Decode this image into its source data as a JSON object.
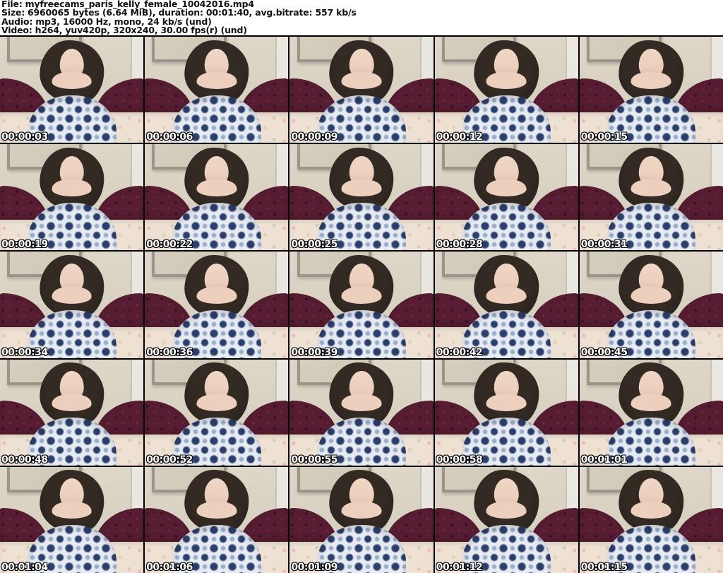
{
  "header": {
    "lines": [
      {
        "label": "File:",
        "value": "myfreecams_paris_kelly_female_10042016.mp4"
      },
      {
        "label": "Size:",
        "value": "6960065 bytes (6.64 MiB), duration: 00:01:40, avg.bitrate: 557 kb/s"
      },
      {
        "label": "Audio:",
        "value": "mp3, 16000 Hz, mono, 24 kb/s (und)"
      },
      {
        "label": "Video:",
        "value": "h264, yuv420p, 320x240, 30.00 fps(r) (und)"
      }
    ]
  },
  "grid": {
    "columns": 5,
    "rows": 5
  },
  "thumbnails": [
    {
      "timestamp": "00:00:03"
    },
    {
      "timestamp": "00:00:06"
    },
    {
      "timestamp": "00:00:09"
    },
    {
      "timestamp": "00:00:12"
    },
    {
      "timestamp": "00:00:15"
    },
    {
      "timestamp": "00:00:19"
    },
    {
      "timestamp": "00:00:22"
    },
    {
      "timestamp": "00:00:25"
    },
    {
      "timestamp": "00:00:28"
    },
    {
      "timestamp": "00:00:31"
    },
    {
      "timestamp": "00:00:34"
    },
    {
      "timestamp": "00:00:36"
    },
    {
      "timestamp": "00:00:39"
    },
    {
      "timestamp": "00:00:42"
    },
    {
      "timestamp": "00:00:45"
    },
    {
      "timestamp": "00:00:48"
    },
    {
      "timestamp": "00:00:52"
    },
    {
      "timestamp": "00:00:55"
    },
    {
      "timestamp": "00:00:58"
    },
    {
      "timestamp": "00:01:01"
    },
    {
      "timestamp": "00:01:04"
    },
    {
      "timestamp": "00:01:06"
    },
    {
      "timestamp": "00:01:09"
    },
    {
      "timestamp": "00:01:12"
    },
    {
      "timestamp": "00:01:15"
    }
  ],
  "colors": {
    "page_bg": "#000000",
    "header_bg": "#ffffff",
    "header_text": "#111111",
    "timestamp_text": "#ffffff",
    "timestamp_outline": "#000000",
    "wall": "#d8d1c2",
    "headboard": "#581d33",
    "bed": "#eee1d3",
    "hair": "#261f1b",
    "skin": "#ecd0bd",
    "shirt_navy": "#2b3f6d",
    "shirt_white": "#e6ebf1"
  }
}
